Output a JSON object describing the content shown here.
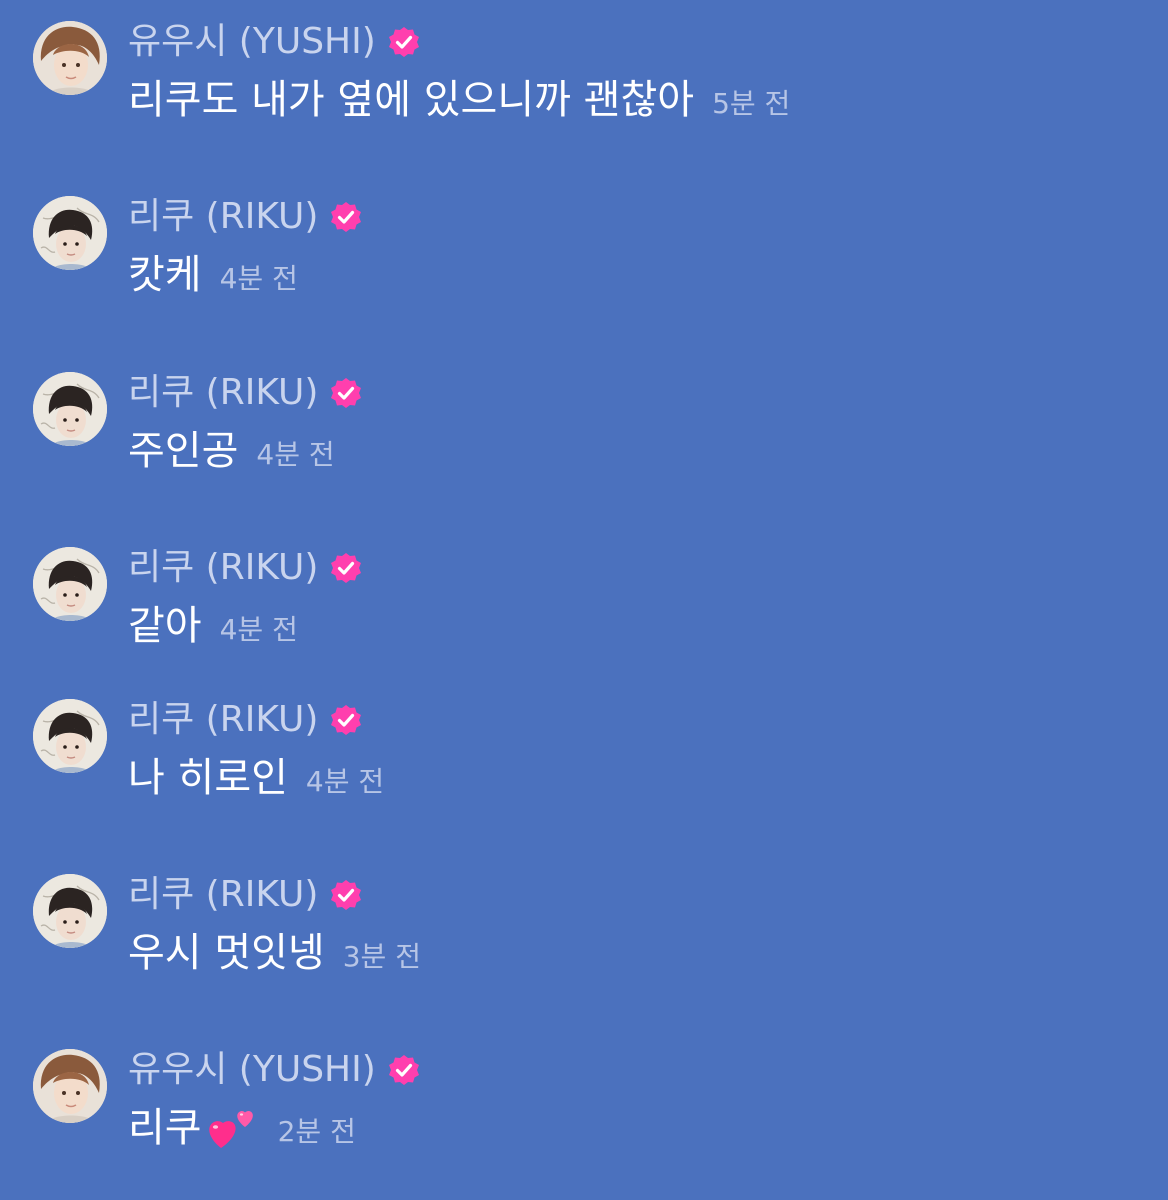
{
  "colors": {
    "background": "#4b71be",
    "name_text": "#c9d4ee",
    "message_text": "#ffffff",
    "timestamp_text": "#b7c5e6",
    "verified_badge": "#ff3fae"
  },
  "messages": [
    {
      "author": "유우시 (YUSHI)",
      "avatar": "yushi-avatar",
      "verified": true,
      "text": "리쿠도 내가 옆에 있으니까 괜찮아",
      "time": "5분 전"
    },
    {
      "author": "리쿠 (RIKU)",
      "avatar": "riku-avatar",
      "verified": true,
      "text": "캇케",
      "time": "4분 전"
    },
    {
      "author": "리쿠 (RIKU)",
      "avatar": "riku-avatar",
      "verified": true,
      "text": "주인공",
      "time": "4분 전"
    },
    {
      "author": "리쿠 (RIKU)",
      "avatar": "riku-avatar",
      "verified": true,
      "text": "같아",
      "time": "4분 전"
    },
    {
      "author": "리쿠 (RIKU)",
      "avatar": "riku-avatar",
      "verified": true,
      "text": "나 히로인",
      "time": "4분 전"
    },
    {
      "author": "리쿠 (RIKU)",
      "avatar": "riku-avatar",
      "verified": true,
      "text": "우시 멋잇넹",
      "time": "3분 전"
    },
    {
      "author": "유우시 (YUSHI)",
      "avatar": "yushi-avatar",
      "verified": true,
      "text": "리쿠",
      "emoji": "two-hearts-emoji",
      "time": "2분 전"
    }
  ]
}
